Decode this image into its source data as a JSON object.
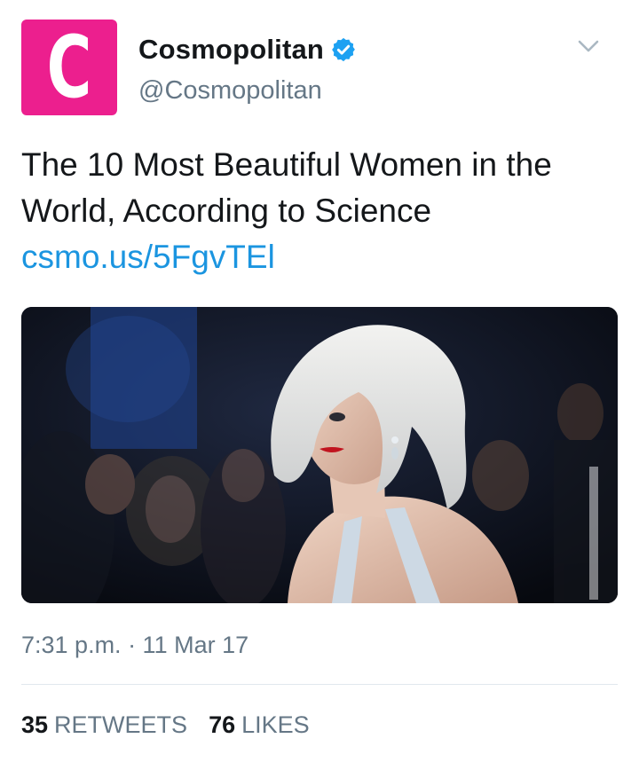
{
  "author": {
    "logo_letter": "C",
    "display_name": "Cosmopolitan",
    "handle": "@Cosmopolitan",
    "verified": true
  },
  "tweet": {
    "text": "The 10 Most Beautiful Women in the World, According to Science ",
    "link": "csmo.us/5FgvTEl",
    "timestamp": "7:31 p.m. · 11 Mar 17"
  },
  "stats": {
    "retweets_count": "35",
    "retweets_label": "RETWEETS",
    "likes_count": "76",
    "likes_label": "LIKES"
  },
  "icons": {
    "logo": "cosmopolitan-logo",
    "verified": "verified-badge-icon",
    "caret": "chevron-down-icon"
  },
  "colors": {
    "brand_pink": "#ec1f8e",
    "verified_blue": "#1da1f2",
    "link_blue": "#1b95e0",
    "secondary_text": "#657786"
  }
}
